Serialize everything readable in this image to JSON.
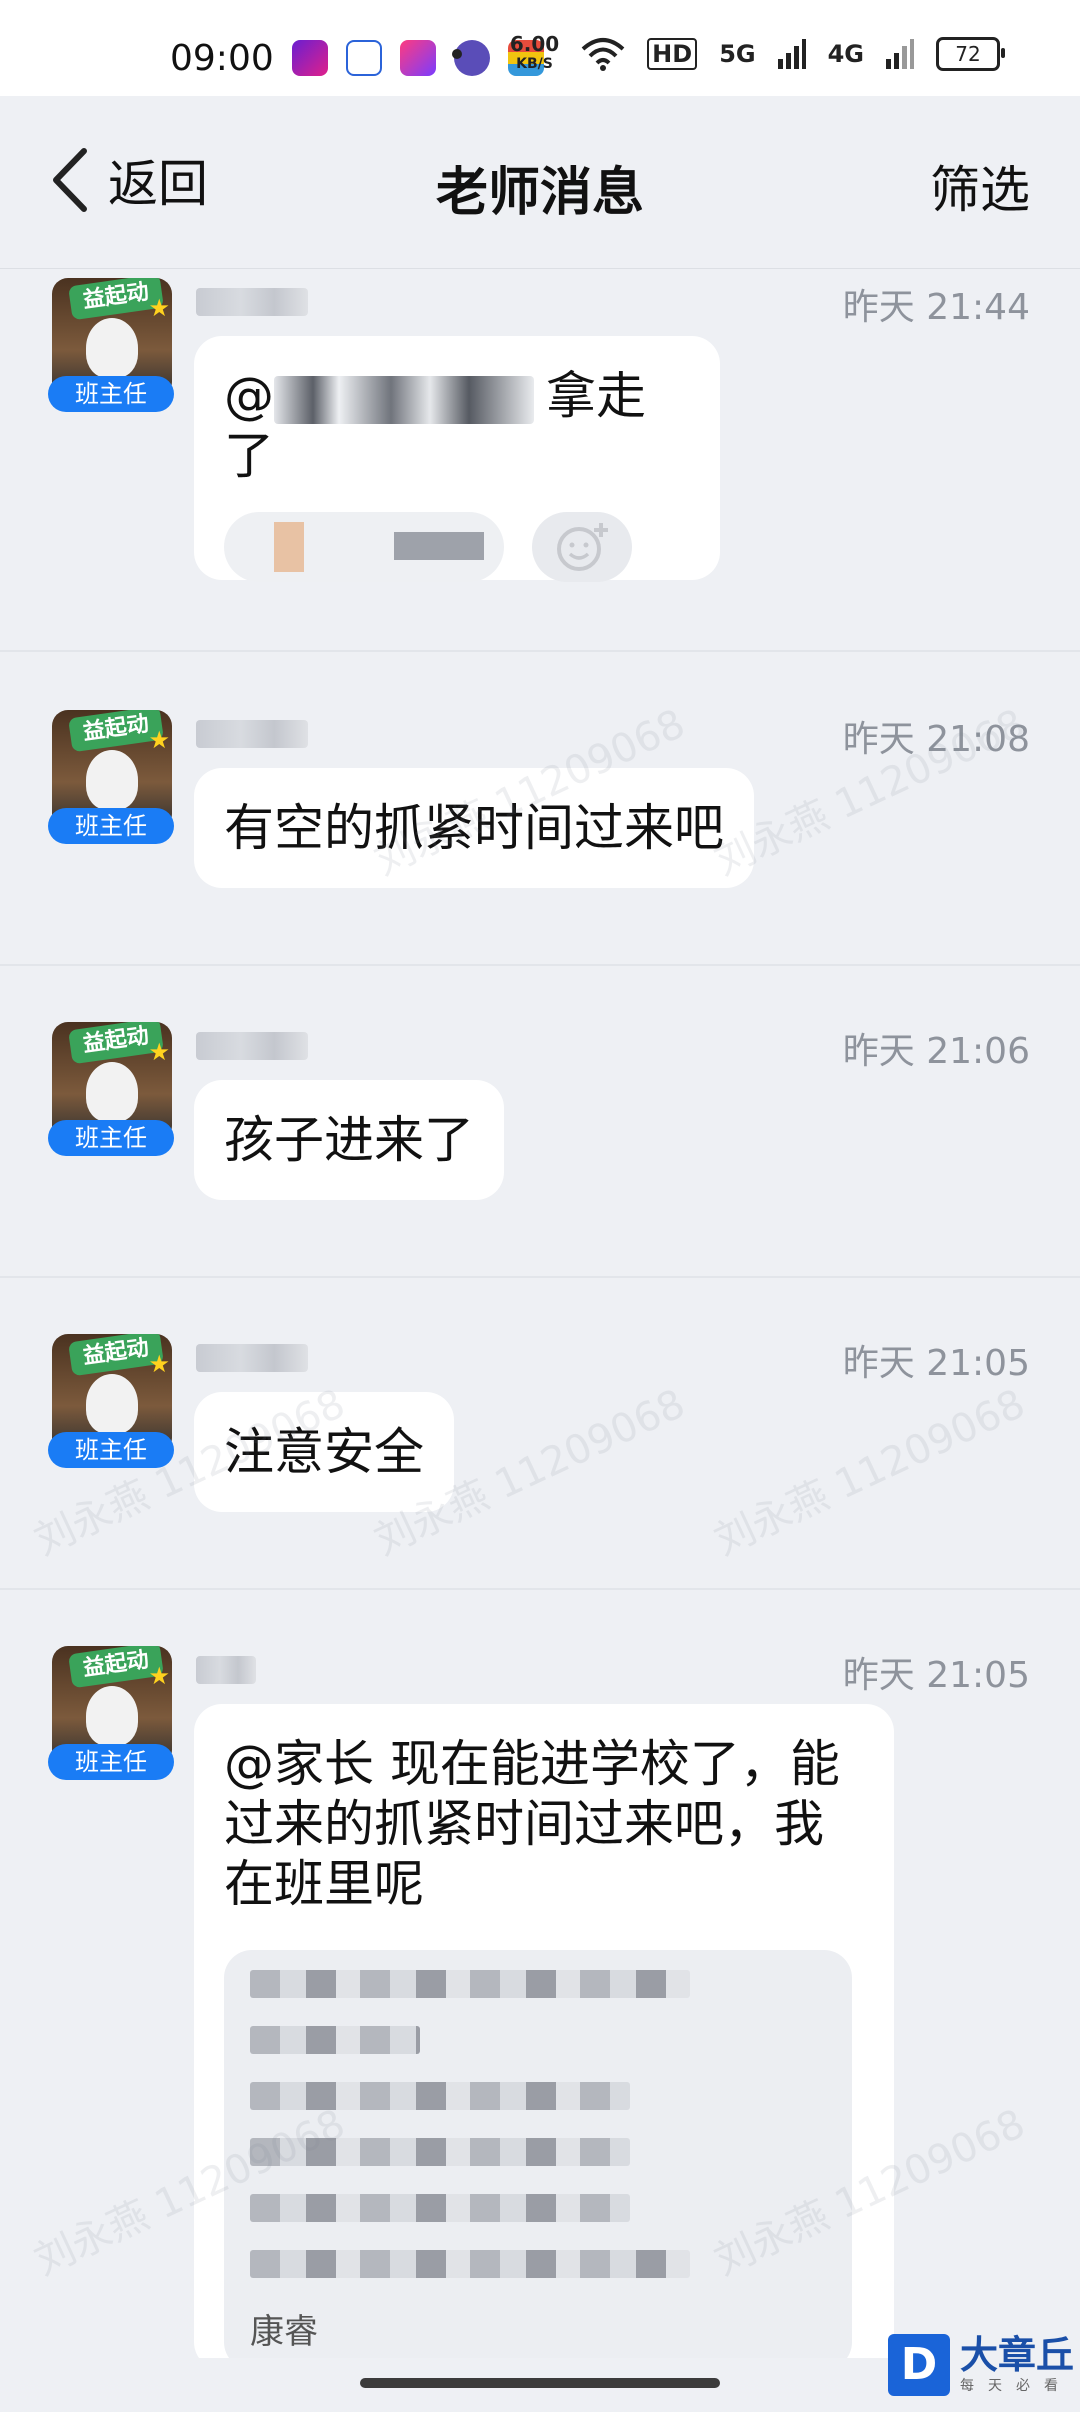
{
  "status_bar": {
    "time": "09:00",
    "net_speed": "6.00",
    "net_unit": "KB/S",
    "hd_label": "HD",
    "sig1_label": "5G",
    "sig2_label": "4G",
    "battery": "72",
    "icons": [
      "video-app-icon",
      "baidu-app-icon",
      "kids-app-icon",
      "purple-app-icon",
      "wallet-app-icon",
      "wifi-icon",
      "signal-icon",
      "battery-icon"
    ]
  },
  "header": {
    "back_label": "返回",
    "title": "老师消息",
    "filter_label": "筛选"
  },
  "messages": [
    {
      "role": "班主任",
      "time": "昨天 21:44",
      "text": "拿走了",
      "has_mention_blur": true,
      "has_reactions": true
    },
    {
      "role": "班主任",
      "time": "昨天 21:08",
      "text": "有空的抓紧时间过来吧"
    },
    {
      "role": "班主任",
      "time": "昨天 21:06",
      "text": "孩子进来了"
    },
    {
      "role": "班主任",
      "time": "昨天 21:05",
      "text": "注意安全"
    },
    {
      "role": "班主任",
      "time": "昨天 21:05",
      "text": "@家长 现在能进学校了，能\n过来的抓紧时间过来吧，我\n在班里呢",
      "quote_tail": "康睿"
    }
  ],
  "avatar_sign": "益起动",
  "watermark": "刘永燕 11209068",
  "brand": {
    "mark": "D",
    "name": "大章丘",
    "sub": "每天必看"
  },
  "colors": {
    "accent": "#1a7cf5",
    "background": "#eef0f4",
    "bubble": "#ffffff",
    "timestamp": "#8e939c"
  }
}
